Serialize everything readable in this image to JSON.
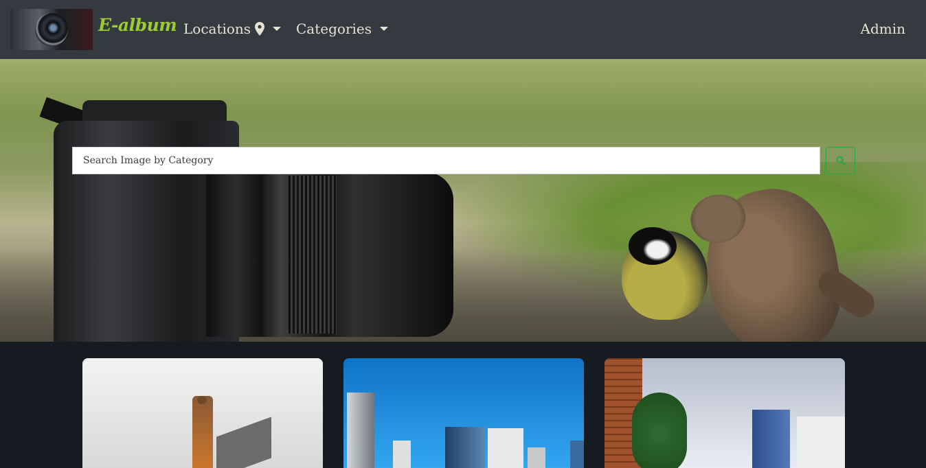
{
  "navbar": {
    "brand_text": "E-album",
    "locations_label": "Locations",
    "categories_label": "Categories",
    "admin_label": "Admin"
  },
  "search": {
    "placeholder": "Search Image by Category"
  },
  "colors": {
    "navbar_bg": "#343a40",
    "brand": "#9acd32",
    "nav_text": "#e8e2d4",
    "page_bg": "#161b22",
    "search_button_border": "#28a745"
  },
  "icons": {
    "location": "map-marker-icon",
    "search": "search-icon",
    "dropdown": "caret-down-icon"
  }
}
